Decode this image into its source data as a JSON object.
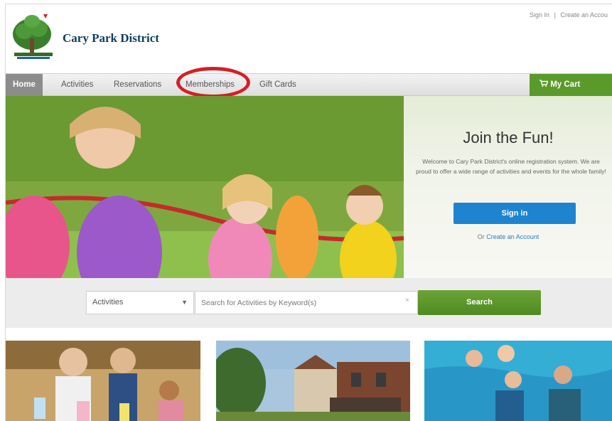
{
  "header": {
    "sign_in_link": "Sign In",
    "separator": "|",
    "create_account_link": "Create an Accou",
    "brand_name": "Cary Park District"
  },
  "nav": {
    "items": [
      "Home",
      "Activities",
      "Reservations",
      "Memberships",
      "Gift Cards"
    ],
    "active": "Home",
    "highlighted": "Memberships",
    "cart_label": "My Cart"
  },
  "hero": {
    "title": "Join the Fun!",
    "text": "Welcome to Cary Park District's online registration system. We are proud to offer a wide range of activities and events for the whole family!",
    "signin_button": "Sign in",
    "create_prefix": "Or",
    "create_link": "Create an Account"
  },
  "search": {
    "category_value": "Activities",
    "keyword_placeholder": "Search for Activities by Keyword(s)",
    "clear_glyph": "×",
    "button_label": "Search"
  },
  "colors": {
    "brand": "#0f3d5e",
    "nav_active": "#8c8c8c",
    "cart_green": "#5a9a2a",
    "search_green": "#5a952c",
    "signin_blue": "#1f84d0",
    "highlight_ring": "#d41f26"
  },
  "icons": {
    "logo": "tree-logo-icon",
    "cart": "cart-icon",
    "dropdown": "chevron-down-icon",
    "clear": "clear-icon"
  }
}
